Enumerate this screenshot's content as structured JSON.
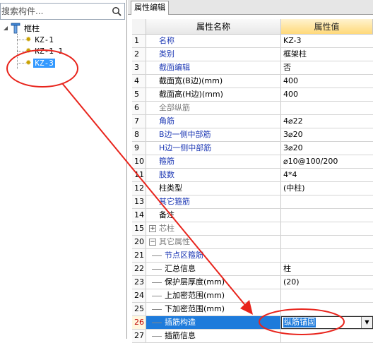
{
  "search": {
    "placeholder": "搜索构件..."
  },
  "tree": {
    "root_label": "框柱",
    "items": [
      {
        "label": "KZ-1"
      },
      {
        "label": "KZ-1-1"
      },
      {
        "label": "KZ-3",
        "selected": true
      }
    ]
  },
  "tab": {
    "label": "属性编辑"
  },
  "grid": {
    "header": {
      "name": "属性名称",
      "value": "属性值"
    },
    "rows": [
      {
        "num": "1",
        "name": "名称",
        "value": "KZ-3",
        "color": "blue"
      },
      {
        "num": "2",
        "name": "类别",
        "value": "框架柱",
        "color": "blue"
      },
      {
        "num": "3",
        "name": "截面编辑",
        "value": "否",
        "color": "blue"
      },
      {
        "num": "4",
        "name": "截面宽(B边)(mm)",
        "value": "400",
        "color": "black"
      },
      {
        "num": "5",
        "name": "截面高(H边)(mm)",
        "value": "400",
        "color": "black"
      },
      {
        "num": "6",
        "name": "全部纵筋",
        "value": "",
        "color": "gray"
      },
      {
        "num": "7",
        "name": "角筋",
        "value": "4⌀22",
        "color": "blue"
      },
      {
        "num": "8",
        "name": "B边一侧中部筋",
        "value": "3⌀20",
        "color": "blue"
      },
      {
        "num": "9",
        "name": "H边一侧中部筋",
        "value": "3⌀20",
        "color": "blue"
      },
      {
        "num": "10",
        "name": "箍筋",
        "value": "⌀10@100/200",
        "color": "blue"
      },
      {
        "num": "11",
        "name": "肢数",
        "value": "4*4",
        "color": "blue"
      },
      {
        "num": "12",
        "name": "柱类型",
        "value": "(中柱)",
        "color": "black"
      },
      {
        "num": "13",
        "name": "其它箍筋",
        "value": "",
        "color": "blue"
      },
      {
        "num": "14",
        "name": "备注",
        "value": "",
        "color": "black"
      },
      {
        "num": "15",
        "name": "芯柱",
        "value": "",
        "color": "gray",
        "expander": "+"
      },
      {
        "num": "20",
        "name": "其它属性",
        "value": "",
        "color": "gray",
        "expander": "−"
      },
      {
        "num": "21",
        "name": "节点区箍筋",
        "value": "",
        "color": "blue",
        "child": true
      },
      {
        "num": "22",
        "name": "汇总信息",
        "value": "柱",
        "color": "black",
        "child": true
      },
      {
        "num": "23",
        "name": "保护层厚度(mm)",
        "value": "(20)",
        "color": "black",
        "child": true
      },
      {
        "num": "24",
        "name": "上加密范围(mm)",
        "value": "",
        "color": "black",
        "child": true
      },
      {
        "num": "25",
        "name": "下加密范围(mm)",
        "value": "",
        "color": "black",
        "child": true
      },
      {
        "num": "26",
        "name": "插筋构造",
        "value": "纵筋锚固",
        "color": "black",
        "child": true,
        "active": true
      },
      {
        "num": "27",
        "name": "插筋信息",
        "value": "",
        "color": "black",
        "child": true
      }
    ]
  },
  "colors": {
    "annotation": "#e8241c",
    "selection": "#1e7bdb",
    "label_blue": "#1f3ab5"
  }
}
